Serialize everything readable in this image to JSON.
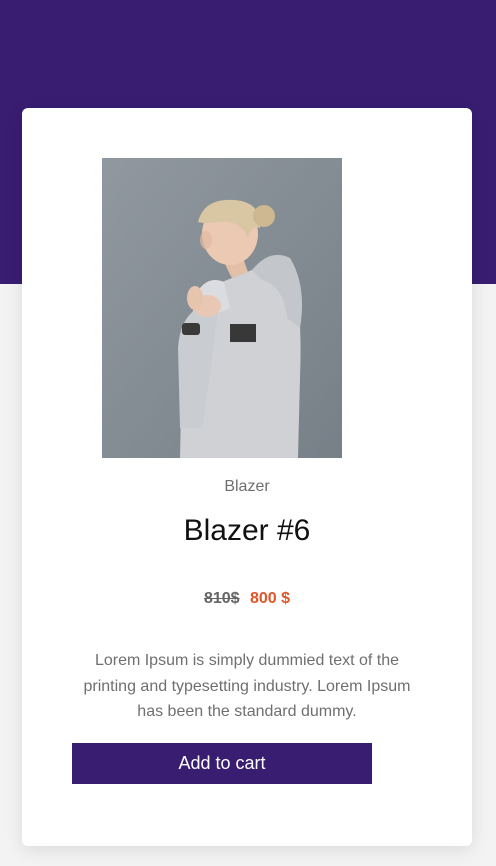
{
  "product": {
    "category": "Blazer",
    "title": "Blazer #6",
    "old_price": "810$",
    "new_price": "800 $",
    "description": "Lorem Ipsum is simply dummied text of the printing and typesetting industry. Lorem Ipsum has been the standard dummy.",
    "add_to_cart_label": "Add to cart",
    "image_description_icon": "product-photo-woman-in-grey-hoodie"
  },
  "colors": {
    "brand_purple": "#381d71",
    "sale_price": "#e0552a",
    "muted_text": "#6f6f6f",
    "background": "#f3f3f3",
    "card": "#ffffff"
  }
}
